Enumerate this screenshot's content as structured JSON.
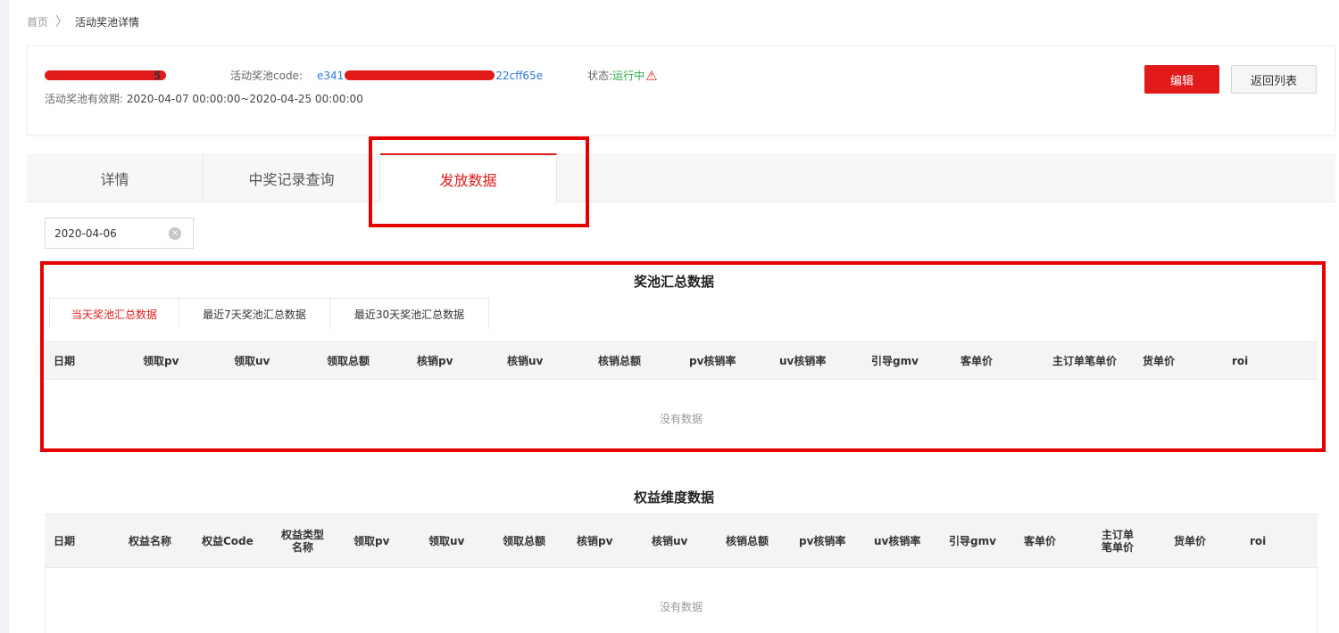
{
  "breadcrumb": {
    "home": "首页",
    "separator": "〉",
    "current": "活动奖池详情"
  },
  "pool": {
    "name_tail": "5",
    "code_label": "活动奖池code:",
    "code_prefix": "e341",
    "code_suffix": "22cff65e",
    "status_label": "状态:",
    "status_value": "运行中",
    "warning_icon": "⚠",
    "validity_label": "活动奖池有效期:",
    "validity_value": "2020-04-07 00:00:00~2020-04-25 00:00:00"
  },
  "actions": {
    "edit": "编辑",
    "back": "返回列表"
  },
  "tabs": [
    {
      "label": "详情"
    },
    {
      "label": "中奖记录查询"
    },
    {
      "label": "发放数据"
    }
  ],
  "filter": {
    "date": "2020-04-06",
    "clear_icon": "×"
  },
  "summary": {
    "title": "奖池汇总数据",
    "subtabs": [
      "当天奖池汇总数据",
      "最近7天奖池汇总数据",
      "最近30天奖池汇总数据"
    ],
    "columns": [
      "日期",
      "领取pv",
      "领取uv",
      "领取总额",
      "核销pv",
      "核销uv",
      "核销总额",
      "pv核销率",
      "uv核销率",
      "引导gmv",
      "客单价",
      "主订单笔单价",
      "货单价",
      "roi"
    ],
    "empty": "没有数据"
  },
  "rights": {
    "title": "权益维度数据",
    "columns": [
      "日期",
      "权益名称",
      "权益Code",
      "权益类型名称",
      "领取pv",
      "领取uv",
      "领取总额",
      "核销pv",
      "核销uv",
      "核销总额",
      "pv核销率",
      "uv核销率",
      "引导gmv",
      "客单价",
      "主订单笔单价",
      "货单价",
      "roi"
    ],
    "empty": "没有数据"
  },
  "colors": {
    "accent": "#e21a1a",
    "link": "#2b7bd6",
    "success": "#2cab49",
    "highlight": "#e60000"
  }
}
